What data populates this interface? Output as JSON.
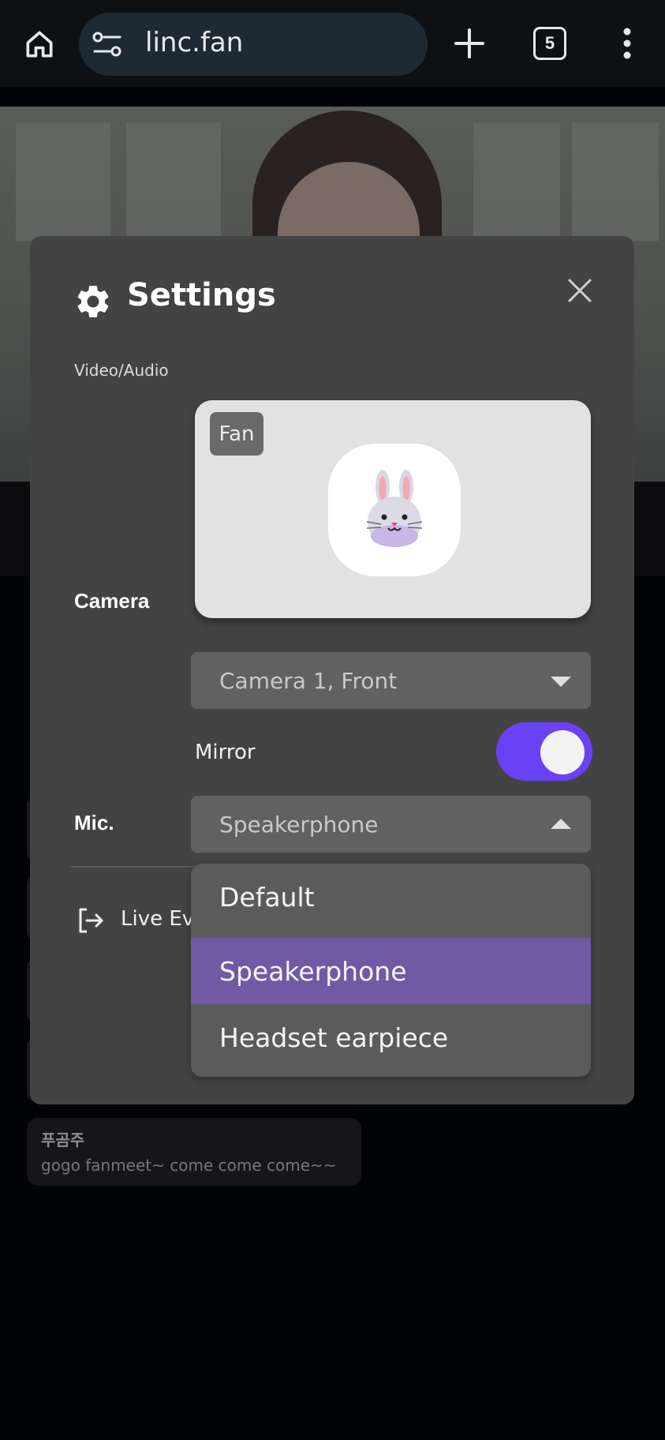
{
  "browser": {
    "url": "linc.fan",
    "tab_count": "5"
  },
  "chat": {
    "username": "푸곰주",
    "message": "gogo fanmeet~ come come come~~"
  },
  "settings": {
    "title": "Settings",
    "section_label": "Video/Audio",
    "preview_badge": "Fan",
    "camera_label": "Camera",
    "camera_value": "Camera 1, Front",
    "mirror_label": "Mirror",
    "mirror_enabled": true,
    "mic_label": "Mic.",
    "mic_value": "Speakerphone",
    "exit_label": "Live Ev",
    "mic_options": [
      "Default",
      "Speakerphone",
      "Headset earpiece"
    ],
    "selected_option": "Speakerphone"
  },
  "colors": {
    "accent": "#6a42f5",
    "selected_option": "#7259a6",
    "modal_bg": "#434343"
  },
  "icons": [
    "home-icon",
    "site-settings-icon",
    "plus-icon",
    "tabs-icon",
    "more-vert-icon",
    "gear-icon",
    "close-icon",
    "bunny-avatar-icon",
    "exit-icon"
  ]
}
